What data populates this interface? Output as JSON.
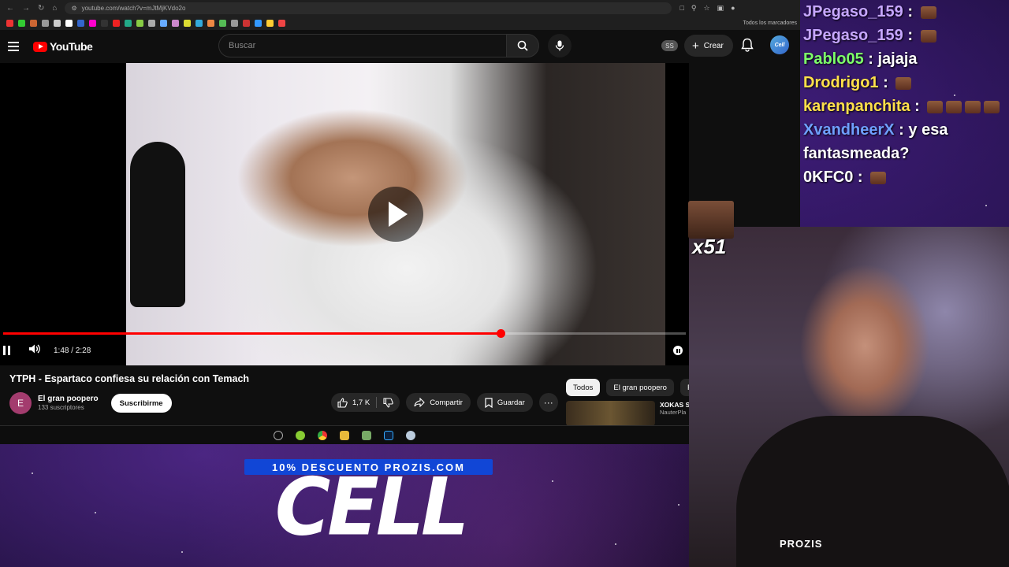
{
  "browser": {
    "url": "youtube.com/watch?v=mJtMjKVdo2o",
    "bookmarks_all": "Todos los marcadores"
  },
  "youtube": {
    "logo_text": "YouTube",
    "search_placeholder": "Buscar",
    "ss_badge": "SS",
    "create_label": "Crear",
    "avatar_text": "Cell"
  },
  "video": {
    "time_display": "1:48 / 2:28",
    "progress_percent": 73,
    "title": "YTPH - Espartaco confiesa su relación con Temach"
  },
  "channel": {
    "avatar_letter": "E",
    "name": "El gran poopero",
    "subscribers": "133 suscriptores",
    "subscribe_label": "Suscribirme"
  },
  "actions": {
    "likes": "1,7 K",
    "share_label": "Compartir",
    "save_label": "Guardar"
  },
  "chips": [
    "Todos",
    "El gran poopero",
    "Re"
  ],
  "recommendation": {
    "title": "XOKAS S",
    "channel": "NauterPla"
  },
  "promo": {
    "banner": "10% DESCUENTO PROZIS.COM",
    "brand": "CELL"
  },
  "chat": [
    {
      "user": "JPegaso_159",
      "text": "",
      "emotes": 1,
      "color": "#c6a7ff"
    },
    {
      "user": "JPegaso_159",
      "text": "",
      "emotes": 1,
      "color": "#c6a7ff"
    },
    {
      "user": "Pablo05",
      "text": "jajaja",
      "emotes": 0,
      "color": "#7dff6a"
    },
    {
      "user": "Drodrigo1",
      "text": "",
      "emotes": 1,
      "color": "#ffe04a"
    },
    {
      "user": "karenpanchita",
      "text": "",
      "emotes": 4,
      "color": "#ffe04a"
    },
    {
      "user": "XvandheerX",
      "text": "y esa fantasmeada?",
      "emotes": 0,
      "color": "#6fa0ff"
    },
    {
      "user": "0KFC0",
      "text": "",
      "emotes": 1,
      "color": "#ffffff"
    }
  ],
  "overlay": {
    "count": "x51"
  },
  "webcam": {
    "shirt_text": "PROZIS"
  }
}
